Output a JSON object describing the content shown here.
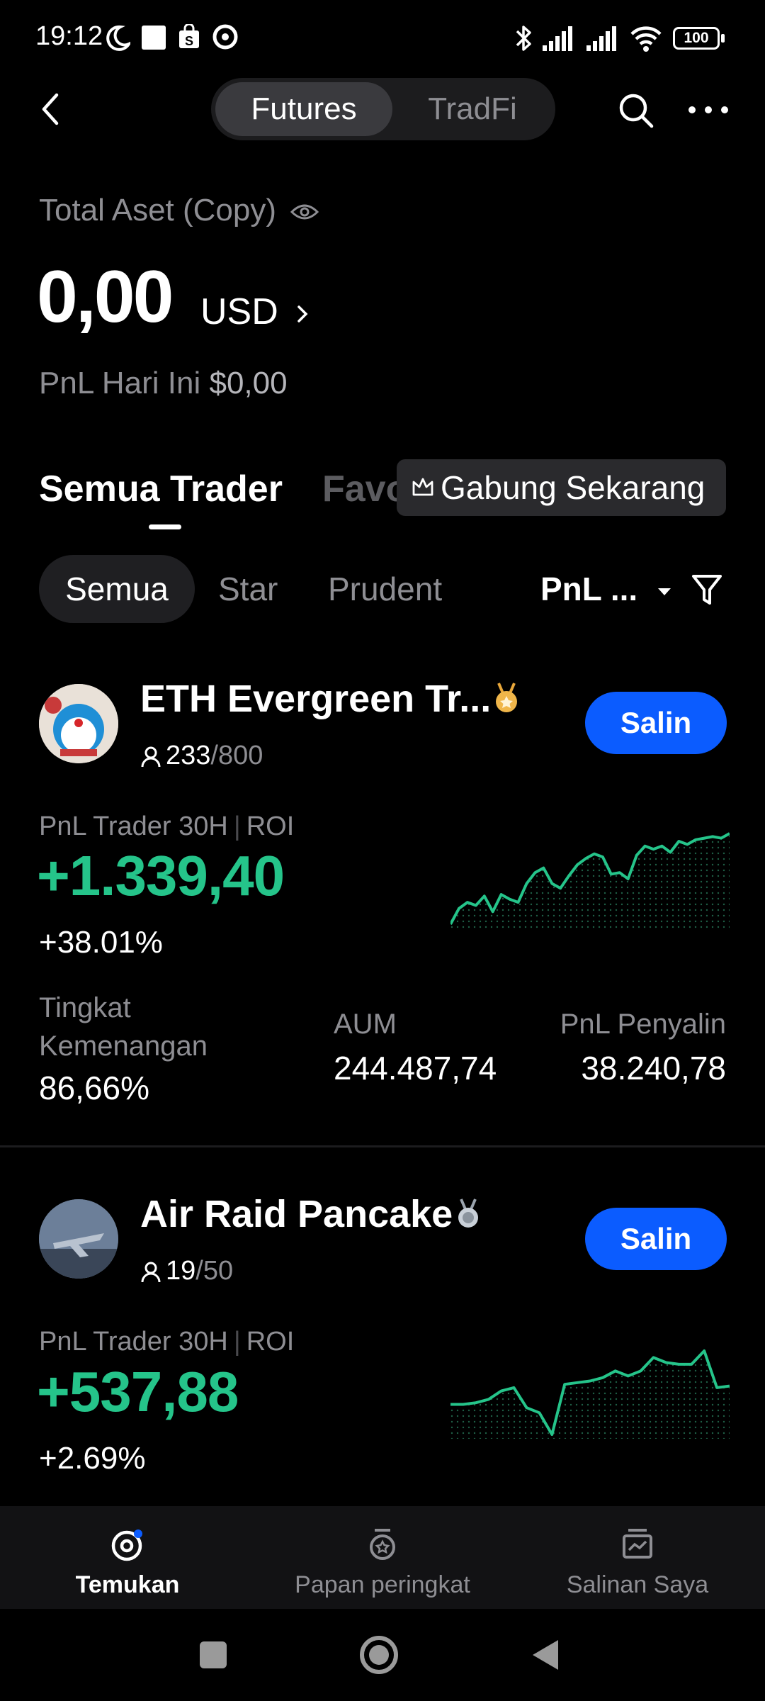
{
  "status_bar": {
    "time": "19:12",
    "battery": "100"
  },
  "header": {
    "tabs": [
      {
        "label": "Futures",
        "active": true
      },
      {
        "label": "TradFi",
        "active": false
      }
    ]
  },
  "summary": {
    "total_asset_label": "Total Aset (Copy)",
    "total_asset_value": "0,00",
    "currency": "USD",
    "pnl_today_label": "PnL Hari Ini",
    "pnl_today_value": "$0,00"
  },
  "trader_tabs": {
    "active": "Semua Trader",
    "second": "Favorit",
    "join_label": "Gabung Sekarang"
  },
  "filters": {
    "chips": [
      "Semua",
      "Star",
      "Prudent"
    ],
    "sort_label": "PnL ..."
  },
  "traders": [
    {
      "name": "ETH Evergreen Tr...",
      "copiers": "233",
      "capacity": "/800",
      "salin_label": "Salin",
      "pnl_label": "PnL Trader 30H",
      "roi_label": "ROI",
      "pnl_value": "+1.339,40",
      "roi_value": "+38.01%",
      "win_label": "Tingkat Kemenangan",
      "win_value": "86,66%",
      "aum_label": "AUM",
      "aum_value": "244.487,74",
      "copier_pnl_label": "PnL Penyalin",
      "copier_pnl_value": "38.240,78",
      "badge_icon": "gold-medal-icon",
      "sparkline": [
        2,
        12,
        16,
        14,
        20,
        10,
        21,
        18,
        16,
        28,
        35,
        38,
        28,
        25,
        33,
        40,
        44,
        47,
        45,
        34,
        35,
        31,
        46,
        52,
        50,
        52,
        48,
        55,
        53,
        56,
        57,
        58,
        57,
        60
      ]
    },
    {
      "name": "Air Raid Pancake",
      "copiers": "19",
      "capacity": "/50",
      "salin_label": "Salin",
      "pnl_label": "PnL Trader 30H",
      "roi_label": "ROI",
      "pnl_value": "+537,88",
      "roi_value": "+2.69%",
      "badge_icon": "silver-medal-icon",
      "sparkline": [
        30,
        30,
        31,
        33,
        38,
        40,
        28,
        25,
        12,
        42,
        43,
        44,
        46,
        50,
        47,
        50,
        58,
        55,
        54,
        54,
        62,
        40,
        41
      ]
    }
  ],
  "bottom_nav": [
    {
      "label": "Temukan",
      "icon": "discover-icon",
      "active": true
    },
    {
      "label": "Papan peringkat",
      "icon": "medal-icon",
      "active": false
    },
    {
      "label": "Salinan Saya",
      "icon": "portfolio-icon",
      "active": false
    }
  ],
  "colors": {
    "accent": "#0b5cff",
    "positive": "#25c48a",
    "background": "#000000"
  }
}
